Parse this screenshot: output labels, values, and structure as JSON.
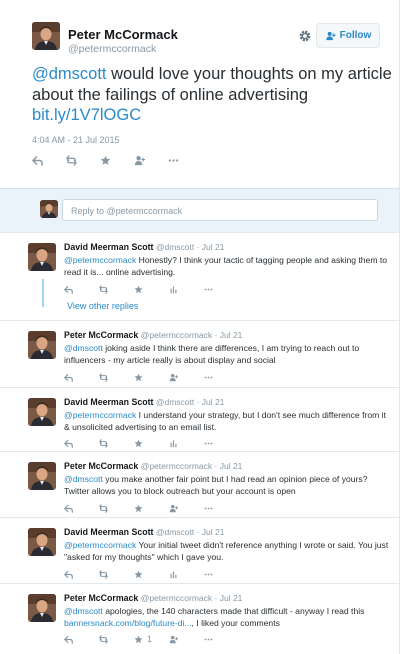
{
  "main_tweet": {
    "name": "Peter McCormack",
    "handle": "@petermccormack",
    "follow_label": "Follow",
    "mention": "@dmscott",
    "text": " would love your thoughts on my article about the failings of online advertising ",
    "link": "bit.ly/1V7lOGC",
    "timestamp": "4:04 AM - 21 Jul 2015"
  },
  "reply_box": {
    "placeholder": "Reply to @petermccormack"
  },
  "conversation": {
    "view_other_replies": "View other replies",
    "replies": [
      {
        "name": "David Meerman Scott",
        "handle": "@dmscott",
        "date": "· Jul 21",
        "mention": "@petermccormack",
        "text": " Honestly? I think your tactic of tagging people and asking them to read it is... online advertising.",
        "like_count": ""
      },
      {
        "name": "Peter McCormack",
        "handle": "@petermccormack",
        "date": "· Jul 21",
        "mention": "@dmscott",
        "text": " joking aside I think there are differences, I am trying to reach out to influencers - my article really is about display and social",
        "like_count": ""
      },
      {
        "name": "David Meerman Scott",
        "handle": "@dmscott",
        "date": "· Jul 21",
        "mention": "@petermccormack",
        "text": " I understand your strategy, but I don't see much difference from it & unsolicited advertising to an email list.",
        "like_count": ""
      },
      {
        "name": "Peter McCormack",
        "handle": "@petermccormack",
        "date": "· Jul 21",
        "mention": "@dmscott",
        "text": " you make another fair point but I had read an opinion piece of yours? Twitter allows you to block outreach but your account is open",
        "like_count": ""
      },
      {
        "name": "David Meerman Scott",
        "handle": "@dmscott",
        "date": "· Jul 21",
        "mention": "@petermccormack",
        "text": " Your initial tweet didn't reference anything I wrote or said. You just \"asked for my thoughts\" which I gave you.",
        "like_count": ""
      },
      {
        "name": "Peter McCormack",
        "handle": "@petermccormack",
        "date": "· Jul 21",
        "mention": "@dmscott",
        "text": " apologies, the 140 characters made that difficult - anyway I read this ",
        "link": "bannersnack.com/blog/future-di...",
        "text_after": ", I liked your comments",
        "like_count": "1"
      }
    ]
  },
  "icons": [
    "gear-icon",
    "follow-person-icon",
    "reply-icon",
    "retweet-icon",
    "like-icon",
    "follow-icon",
    "more-icon",
    "analytics-icon"
  ],
  "colors": {
    "link": "#2a8ac8",
    "muted": "#8899a6",
    "thread_line": "#1da1f2",
    "reply_bg": "#eaf3fa"
  }
}
